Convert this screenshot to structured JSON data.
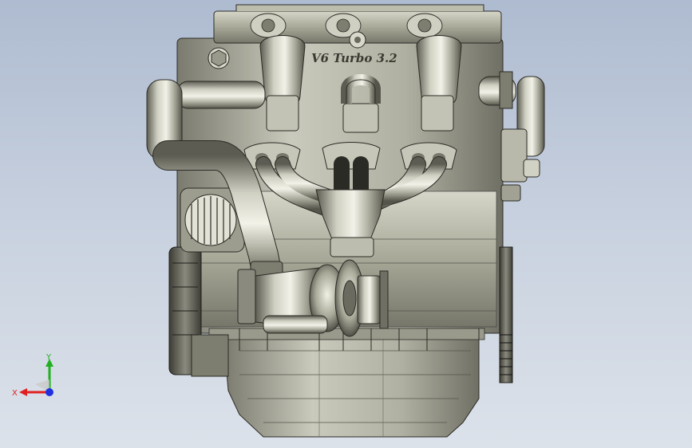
{
  "model": {
    "engraving": "V6 Turbo 3.2"
  },
  "triad": {
    "x_label": "X",
    "y_label": "Y",
    "x_color": "#e02020",
    "y_color": "#22b022",
    "z_color": "#2030e0"
  },
  "colors": {
    "background_top": "#aebbd0",
    "background_bottom": "#dce2ea",
    "engine_body": "#a9a99a",
    "engine_shadow": "#6f6f64",
    "engine_highlight": "#dcdcd0",
    "edge": "#2b2b26"
  }
}
